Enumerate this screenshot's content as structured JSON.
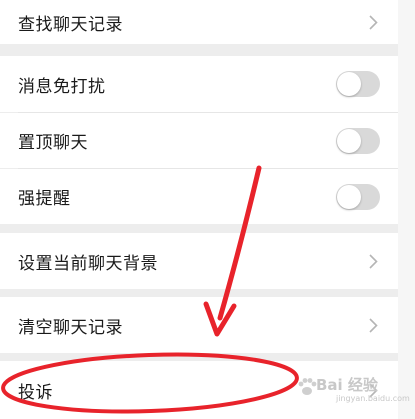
{
  "settings": {
    "find_history": "查找聊天记录",
    "mute": "消息免打扰",
    "sticky": "置顶聊天",
    "strong_remind": "强提醒",
    "set_background": "设置当前聊天背景",
    "clear_history": "清空聊天记录",
    "complain": "投诉"
  },
  "toggles": {
    "mute_on": false,
    "sticky_on": false,
    "strong_remind_on": false
  },
  "watermark": {
    "main": "Bai 经验",
    "sub": "jingyan.baidu.com"
  },
  "colors": {
    "annotation_red": "#e8232b",
    "toggle_off": "#d9d9d9",
    "background": "#ededed"
  }
}
